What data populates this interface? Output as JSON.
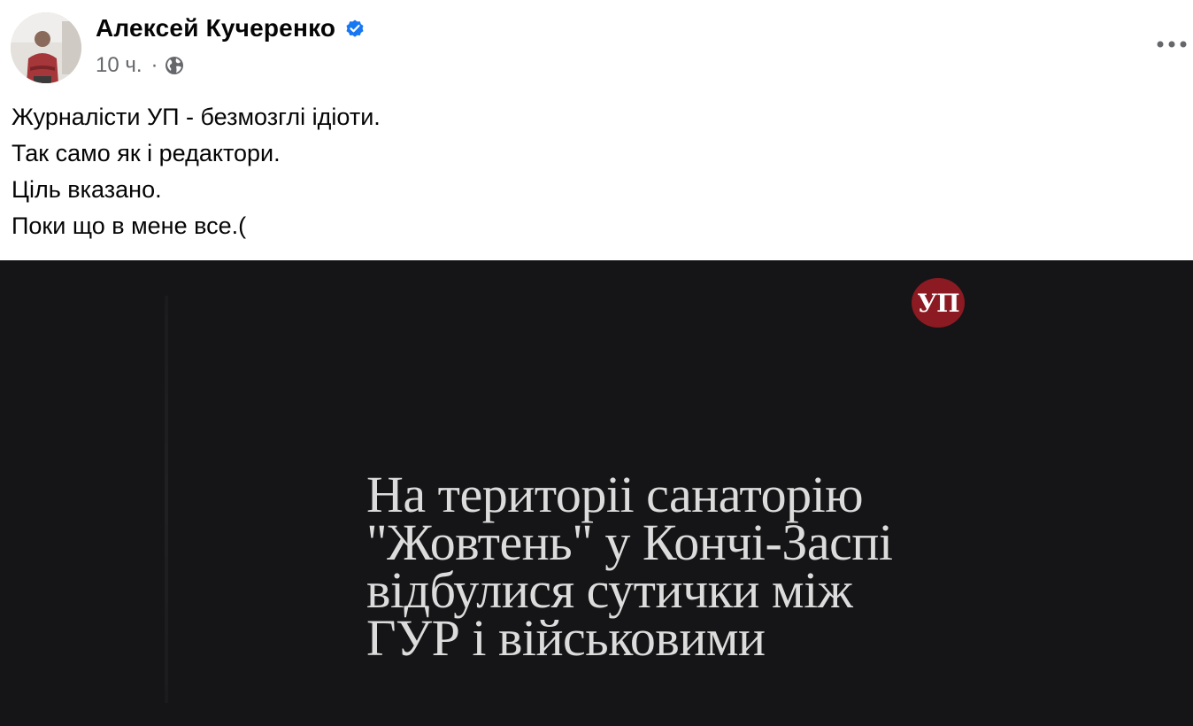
{
  "post": {
    "author": "Алексей Кучеренко",
    "verified": true,
    "time": "10 ч.",
    "separator": "·",
    "audience_icon": "globe-icon",
    "more_icon": "more-horizontal-icon",
    "text_lines": [
      "Журналісти УП - безмозглі ідіоти.",
      "Так само як і редактори.",
      "Ціль вказано.",
      "Поки що в мене все.("
    ]
  },
  "media": {
    "logo_text": "УП",
    "headline_lines": [
      "На територіі санаторію",
      "\"Жовтень\" у Кончі-Заспі",
      "відбулися сутички між",
      "ГУР і військовими"
    ]
  },
  "colors": {
    "verified_blue": "#1877f2",
    "secondary_text": "#65676b",
    "media_bg": "#151517",
    "logo_red": "#8b1a22"
  }
}
